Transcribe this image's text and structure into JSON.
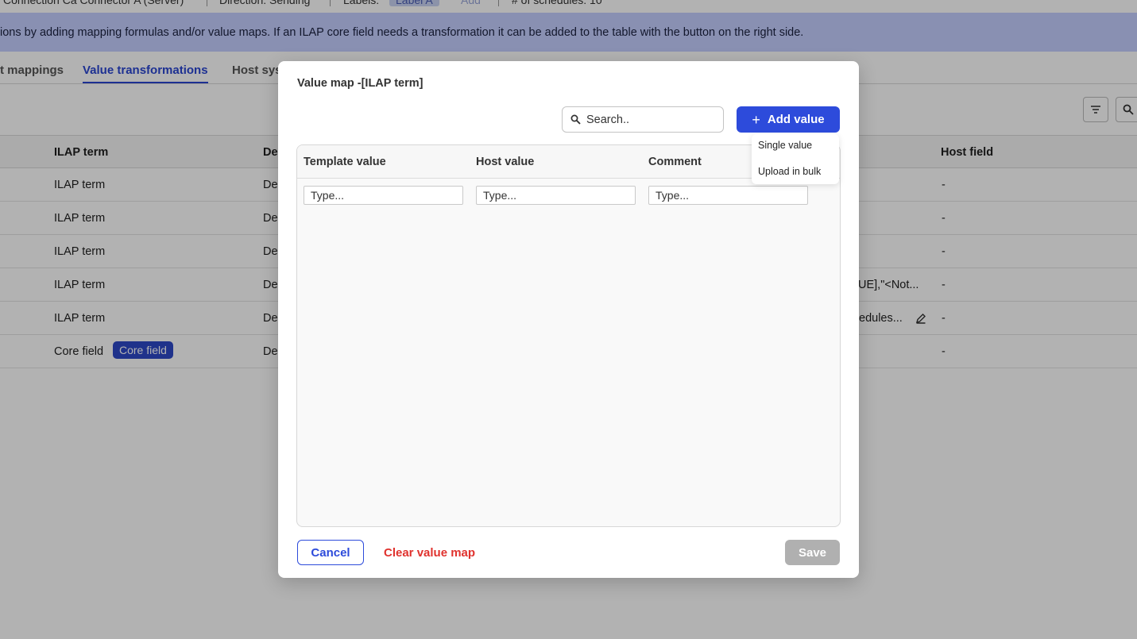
{
  "topbar": {
    "connector": "Connection Ca Connector A (Server)",
    "direction": "Direction: Sending",
    "labels_label": "Labels:",
    "label_chip": "Label A",
    "add_link": "Add",
    "schedules": "# of schedules: 10"
  },
  "banner": {
    "text": "ions by adding mapping formulas and/or value maps. If an ILAP core field needs a transformation it can be added to the table with the button on the right side."
  },
  "tabs": [
    {
      "label": "t mappings"
    },
    {
      "label": "Value transformations"
    },
    {
      "label": "Host sys"
    }
  ],
  "bg_table": {
    "headers": {
      "ilap_term": "ILAP term",
      "description": "De",
      "host_field": "Host field"
    },
    "rows": [
      {
        "term": "ILAP term",
        "desc": "De",
        "mapping": "",
        "host": "-"
      },
      {
        "term": "ILAP term",
        "desc": "De",
        "mapping": "",
        "host": "-"
      },
      {
        "term": "ILAP term",
        "desc": "De",
        "mapping": "",
        "host": "-"
      },
      {
        "term": "ILAP term",
        "desc": "De",
        "mapping": "UE],\"<Not...",
        "host": "-"
      },
      {
        "term": "ILAP term",
        "desc": "De",
        "mapping": "edules...",
        "host": "-"
      },
      {
        "term": "Core field",
        "chip": "Core field",
        "desc": "De",
        "mapping": "",
        "host": "-"
      }
    ]
  },
  "icons": {
    "filter": "filter-icon",
    "search": "search-icon",
    "edit": "pencil-icon",
    "plus": "plus-icon"
  },
  "modal": {
    "title": "Value map -[ILAP term]",
    "search_placeholder": "Search..",
    "add_value_label": "Add value",
    "dropdown": [
      "Single value",
      "Upload in bulk"
    ],
    "columns": {
      "template_value": "Template value",
      "host_value": "Host value",
      "comment": "Comment"
    },
    "new_row": {
      "template_placeholder": "Type...",
      "host_placeholder": "Type...",
      "comment_placeholder": "Type..."
    },
    "cancel_label": "Cancel",
    "clear_label": "Clear value map",
    "save_label": "Save"
  },
  "colors": {
    "primary": "#2d4bdb",
    "danger": "#e0322e",
    "disabled": "#b0b0b0",
    "banner": "#c5ceff"
  }
}
